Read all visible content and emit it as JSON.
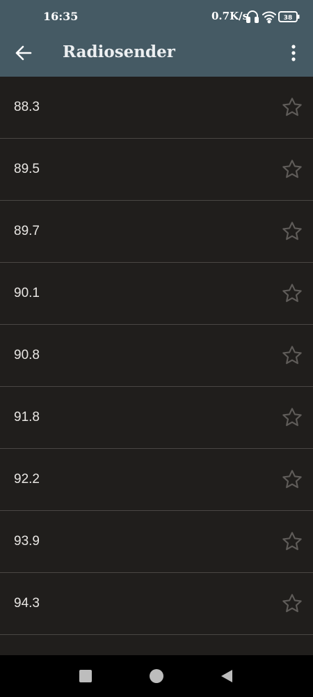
{
  "status_bar": {
    "time": "16:35",
    "speed": "0.7K/s",
    "battery": "38",
    "icons": [
      "headphones-icon",
      "wifi-icon",
      "battery-icon"
    ]
  },
  "toolbar": {
    "title": "Radiosender",
    "back_icon": "arrow-left-icon",
    "menu_icon": "more-vert-icon"
  },
  "stations": [
    {
      "frequency": "88.3"
    },
    {
      "frequency": "89.5"
    },
    {
      "frequency": "89.7"
    },
    {
      "frequency": "90.1"
    },
    {
      "frequency": "90.8"
    },
    {
      "frequency": "91.8"
    },
    {
      "frequency": "92.2"
    },
    {
      "frequency": "93.9"
    },
    {
      "frequency": "94.3"
    },
    {
      "frequency": ""
    }
  ],
  "colors": {
    "app_bar": "#455a64",
    "background": "#201e1c",
    "divider": "#4a4744",
    "star_outline": "#5f5c59",
    "text": "#e8e6e3"
  },
  "nav_bar": {
    "icons": [
      "recents-square-icon",
      "home-circle-icon",
      "back-triangle-icon"
    ]
  }
}
